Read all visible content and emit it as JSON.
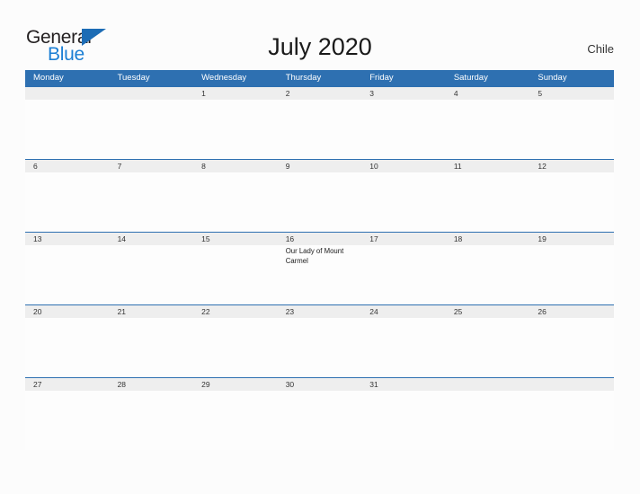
{
  "branding": {
    "logo_primary": "General",
    "logo_secondary": "Blue",
    "logo_triangle_icon": "triangle-icon",
    "primary_color": "#231f20",
    "secondary_color": "#1c7fd4",
    "triangle_color": "#1c6cb5"
  },
  "header": {
    "title": "July 2020",
    "region": "Chile",
    "header_bg_color": "#2e70b1",
    "date_strip_color": "#eeeeee",
    "page_bg_color": "#fcfcfc"
  },
  "calendar": {
    "weekdays": [
      "Monday",
      "Tuesday",
      "Wednesday",
      "Thursday",
      "Friday",
      "Saturday",
      "Sunday"
    ],
    "weeks": [
      {
        "days": [
          {
            "date": "",
            "event": ""
          },
          {
            "date": "",
            "event": ""
          },
          {
            "date": "1",
            "event": ""
          },
          {
            "date": "2",
            "event": ""
          },
          {
            "date": "3",
            "event": ""
          },
          {
            "date": "4",
            "event": ""
          },
          {
            "date": "5",
            "event": ""
          }
        ]
      },
      {
        "days": [
          {
            "date": "6",
            "event": ""
          },
          {
            "date": "7",
            "event": ""
          },
          {
            "date": "8",
            "event": ""
          },
          {
            "date": "9",
            "event": ""
          },
          {
            "date": "10",
            "event": ""
          },
          {
            "date": "11",
            "event": ""
          },
          {
            "date": "12",
            "event": ""
          }
        ]
      },
      {
        "days": [
          {
            "date": "13",
            "event": ""
          },
          {
            "date": "14",
            "event": ""
          },
          {
            "date": "15",
            "event": ""
          },
          {
            "date": "16",
            "event": "Our Lady of Mount Carmel"
          },
          {
            "date": "17",
            "event": ""
          },
          {
            "date": "18",
            "event": ""
          },
          {
            "date": "19",
            "event": ""
          }
        ]
      },
      {
        "days": [
          {
            "date": "20",
            "event": ""
          },
          {
            "date": "21",
            "event": ""
          },
          {
            "date": "22",
            "event": ""
          },
          {
            "date": "23",
            "event": ""
          },
          {
            "date": "24",
            "event": ""
          },
          {
            "date": "25",
            "event": ""
          },
          {
            "date": "26",
            "event": ""
          }
        ]
      },
      {
        "days": [
          {
            "date": "27",
            "event": ""
          },
          {
            "date": "28",
            "event": ""
          },
          {
            "date": "29",
            "event": ""
          },
          {
            "date": "30",
            "event": ""
          },
          {
            "date": "31",
            "event": ""
          },
          {
            "date": "",
            "event": ""
          },
          {
            "date": "",
            "event": ""
          }
        ]
      }
    ]
  }
}
